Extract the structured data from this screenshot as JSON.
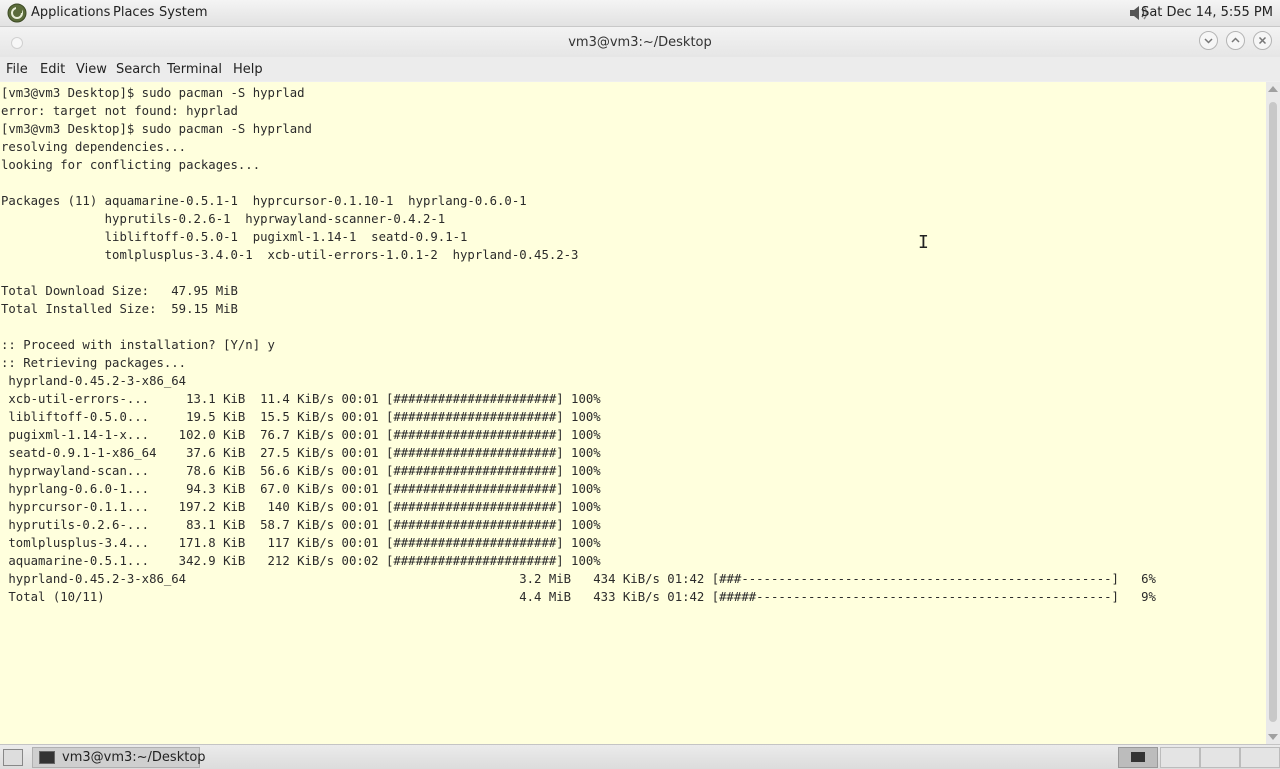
{
  "top_panel": {
    "menus": [
      "Applications",
      "Places",
      "System"
    ],
    "clock": "Sat Dec 14,  5:55 PM"
  },
  "window": {
    "title": "vm3@vm3:~/Desktop"
  },
  "menubar": {
    "items": [
      "File",
      "Edit",
      "View",
      "Search",
      "Terminal",
      "Help"
    ]
  },
  "terminal": {
    "lines": [
      "[vm3@vm3 Desktop]$ sudo pacman -S hyprlad",
      "error: target not found: hyprlad",
      "[vm3@vm3 Desktop]$ sudo pacman -S hyprland",
      "resolving dependencies...",
      "looking for conflicting packages...",
      "",
      "Packages (11) aquamarine-0.5.1-1  hyprcursor-0.1.10-1  hyprlang-0.6.0-1",
      "              hyprutils-0.2.6-1  hyprwayland-scanner-0.4.2-1",
      "              libliftoff-0.5.0-1  pugixml-1.14-1  seatd-0.9.1-1",
      "              tomlplusplus-3.4.0-1  xcb-util-errors-1.0.1-2  hyprland-0.45.2-3",
      "",
      "Total Download Size:   47.95 MiB",
      "Total Installed Size:  59.15 MiB",
      "",
      ":: Proceed with installation? [Y/n] y",
      ":: Retrieving packages...",
      " hyprland-0.45.2-3-x86_64",
      " xcb-util-errors-...     13.1 KiB  11.4 KiB/s 00:01 [######################] 100%",
      " libliftoff-0.5.0...     19.5 KiB  15.5 KiB/s 00:01 [######################] 100%",
      " pugixml-1.14-1-x...    102.0 KiB  76.7 KiB/s 00:01 [######################] 100%",
      " seatd-0.9.1-1-x86_64    37.6 KiB  27.5 KiB/s 00:01 [######################] 100%",
      " hyprwayland-scan...     78.6 KiB  56.6 KiB/s 00:01 [######################] 100%",
      " hyprlang-0.6.0-1...     94.3 KiB  67.0 KiB/s 00:01 [######################] 100%",
      " hyprcursor-0.1.1...    197.2 KiB   140 KiB/s 00:01 [######################] 100%",
      " hyprutils-0.2.6-...     83.1 KiB  58.7 KiB/s 00:01 [######################] 100%",
      " tomlplusplus-3.4...    171.8 KiB   117 KiB/s 00:01 [######################] 100%",
      " aquamarine-0.5.1...    342.9 KiB   212 KiB/s 00:02 [######################] 100%",
      " hyprland-0.45.2-3-x86_64                                             3.2 MiB   434 KiB/s 01:42 [###--------------------------------------------------]   6%",
      " Total (10/11)                                                        4.4 MiB   433 KiB/s 01:42 [#####------------------------------------------------]   9%"
    ]
  },
  "taskbar": {
    "task_label": "vm3@vm3:~/Desktop"
  }
}
